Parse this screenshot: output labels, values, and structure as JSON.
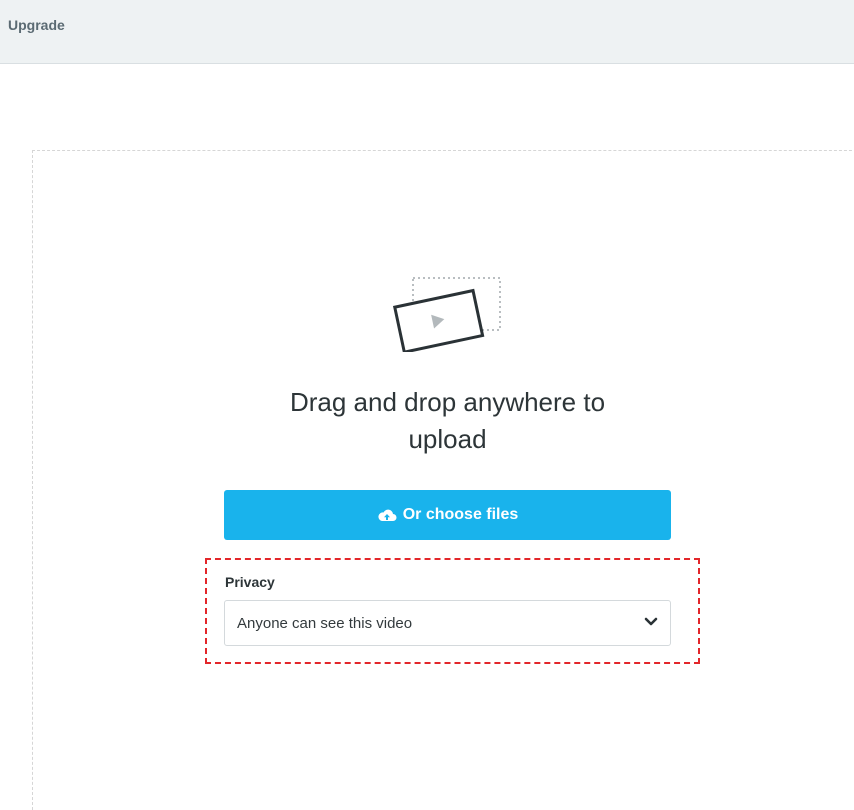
{
  "header": {
    "upgrade_label": "Upgrade"
  },
  "upload": {
    "headline_line1": "Drag and drop anywhere to",
    "headline_line2": "upload",
    "choose_button_label": "Or choose files",
    "choose_button_icon": "cloud-upload-icon",
    "accent_color": "#19b3ec"
  },
  "privacy": {
    "label": "Privacy",
    "selected": "Anyone can see this video",
    "highlight_color": "#e3262a"
  }
}
